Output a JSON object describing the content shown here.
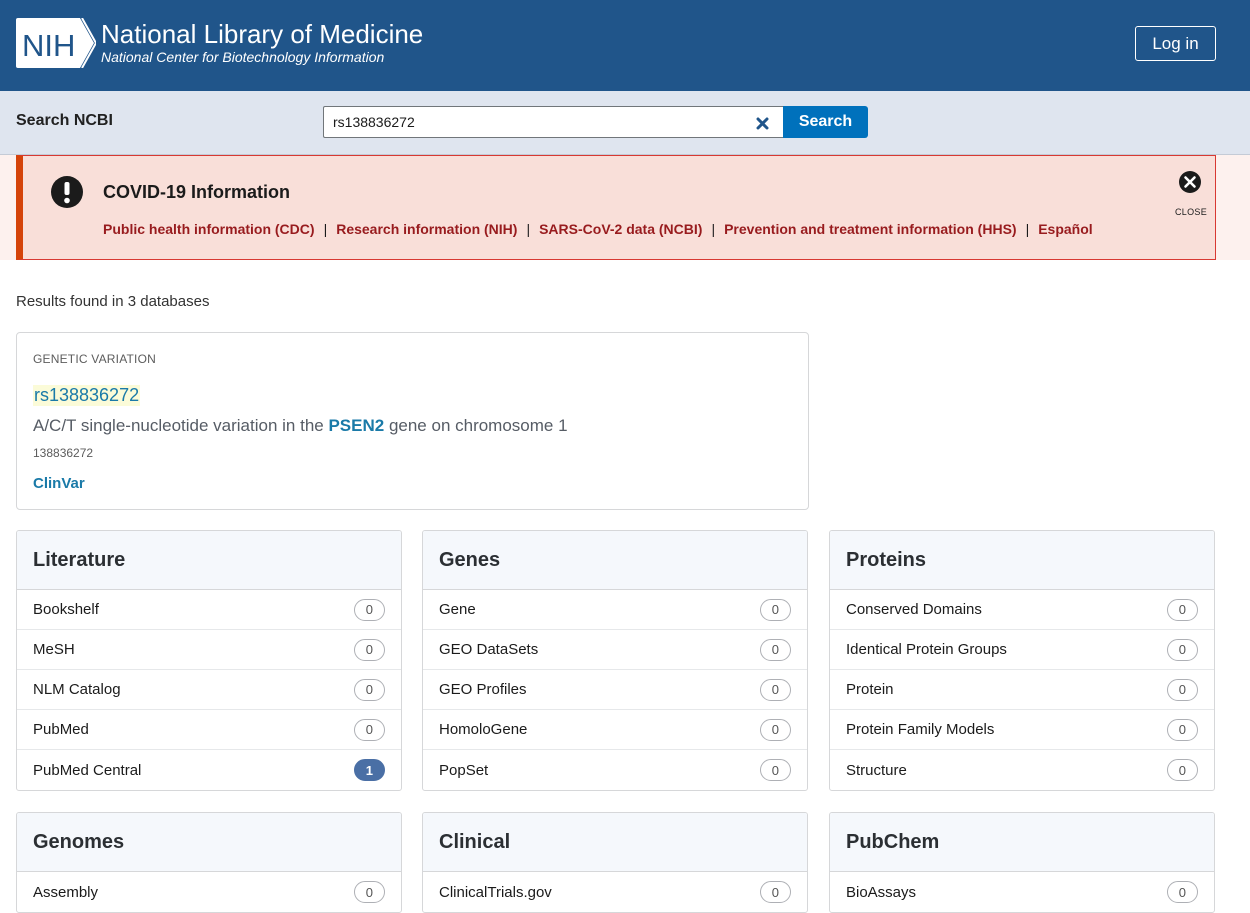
{
  "header": {
    "logo_text": "NIH",
    "org_name": "National Library of Medicine",
    "org_sub": "National Center for Biotechnology Information",
    "login_label": "Log in",
    "bg_color": "#20558a"
  },
  "search": {
    "label": "Search NCBI",
    "value": "rs138836272",
    "button_label": "Search",
    "clear_icon": "close-x-icon"
  },
  "alert": {
    "title": "COVID-19 Information",
    "icon": "exclamation-circle-icon",
    "links": [
      "Public health information (CDC)",
      "Research information (NIH)",
      "SARS-CoV-2 data (NCBI)",
      "Prevention and treatment information (HHS)",
      "Español"
    ],
    "separator": "|",
    "close_label": "CLOSE"
  },
  "results": {
    "count_text": "Results found in 3 databases",
    "feature": {
      "type": "GENETIC VARIATION",
      "id": "rs138836272",
      "desc_before": "A/C/T single-nucleotide variation in the ",
      "gene": "PSEN2",
      "desc_after": " gene on chromosome 1",
      "number": "138836272",
      "link": "ClinVar"
    }
  },
  "categories": [
    {
      "title": "Literature",
      "items": [
        {
          "name": "Bookshelf",
          "count": "0"
        },
        {
          "name": "MeSH",
          "count": "0"
        },
        {
          "name": "NLM Catalog",
          "count": "0"
        },
        {
          "name": "PubMed",
          "count": "0"
        },
        {
          "name": "PubMed Central",
          "count": "1"
        }
      ]
    },
    {
      "title": "Genes",
      "items": [
        {
          "name": "Gene",
          "count": "0"
        },
        {
          "name": "GEO DataSets",
          "count": "0"
        },
        {
          "name": "GEO Profiles",
          "count": "0"
        },
        {
          "name": "HomoloGene",
          "count": "0"
        },
        {
          "name": "PopSet",
          "count": "0"
        }
      ]
    },
    {
      "title": "Proteins",
      "items": [
        {
          "name": "Conserved Domains",
          "count": "0"
        },
        {
          "name": "Identical Protein Groups",
          "count": "0"
        },
        {
          "name": "Protein",
          "count": "0"
        },
        {
          "name": "Protein Family Models",
          "count": "0"
        },
        {
          "name": "Structure",
          "count": "0"
        }
      ]
    },
    {
      "title": "Genomes",
      "items": [
        {
          "name": "Assembly",
          "count": "0"
        }
      ]
    },
    {
      "title": "Clinical",
      "items": [
        {
          "name": "ClinicalTrials.gov",
          "count": "0"
        }
      ]
    },
    {
      "title": "PubChem",
      "items": [
        {
          "name": "BioAssays",
          "count": "0"
        }
      ]
    }
  ]
}
